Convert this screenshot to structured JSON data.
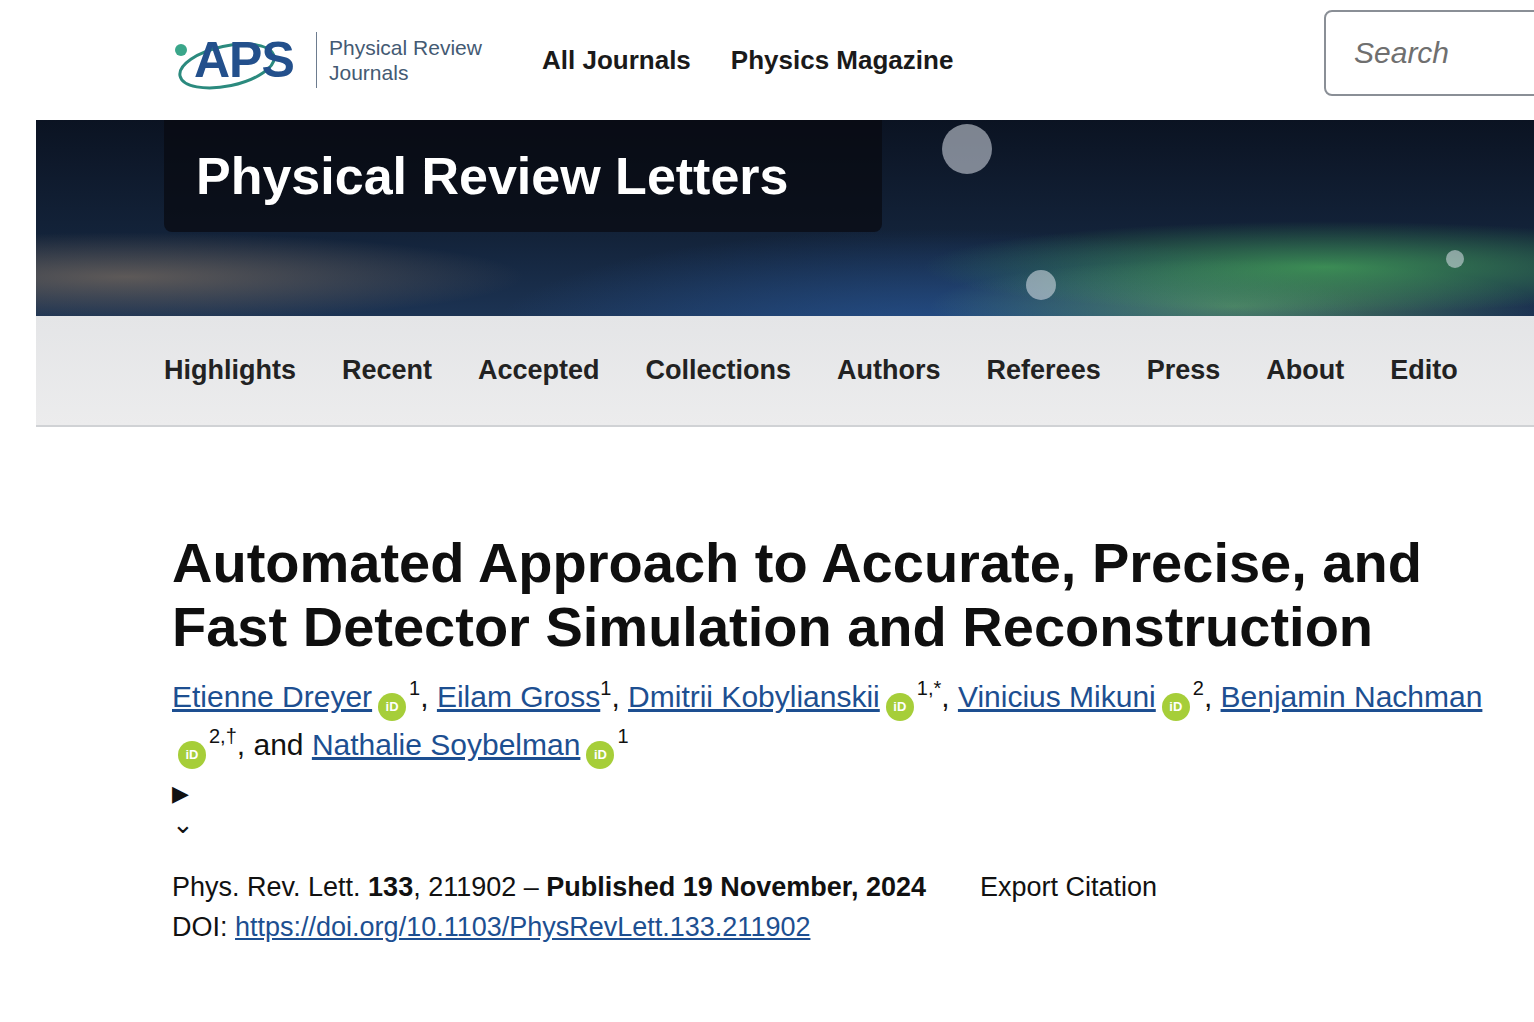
{
  "header": {
    "logo": {
      "mark": "APS",
      "lines": [
        "Physical Review",
        "Journals"
      ]
    },
    "links": [
      "All Journals",
      "Physics Magazine"
    ],
    "search": {
      "placeholder": "Search"
    }
  },
  "banner": {
    "title": "Physical Review Letters"
  },
  "nav": {
    "items": [
      "Highlights",
      "Recent",
      "Accepted",
      "Collections",
      "Authors",
      "Referees",
      "Press",
      "About",
      "Edito"
    ]
  },
  "article": {
    "title": "Automated Approach to Accurate, Precise, and Fast Detector Simulation and Reconstruction",
    "orcid_label": "iD",
    "authors": [
      {
        "name": "Etienne Dreyer",
        "orcid": true,
        "sup": "1",
        "separator": ", "
      },
      {
        "name": "Eilam Gross",
        "orcid": false,
        "sup": "1",
        "separator": ", "
      },
      {
        "name": "Dmitrii Kobylianskii",
        "orcid": true,
        "sup": "1,*",
        "separator": ", "
      },
      {
        "name": "Vinicius Mikuni",
        "orcid": true,
        "sup": "2",
        "separator": ", "
      },
      {
        "name": "Benjamin Nachman",
        "orcid": true,
        "sup": "2,†",
        "separator": ", and "
      },
      {
        "name": "Nathalie Soybelman",
        "orcid": true,
        "sup": "1",
        "separator": ""
      }
    ],
    "toggles": [
      "▶",
      "⌄"
    ],
    "citation": [
      {
        "text": "Phys. Rev. Lett. ",
        "bold": false
      },
      {
        "text": "133",
        "bold": true
      },
      {
        "text": ", 211902 – ",
        "bold": false
      },
      {
        "text": "Published 19 November, 2024",
        "bold": true
      }
    ],
    "export": "Export Citation",
    "doi": {
      "label": "DOI:",
      "link": "https://doi.org/10.1103/PhysRevLett.133.211902"
    }
  }
}
